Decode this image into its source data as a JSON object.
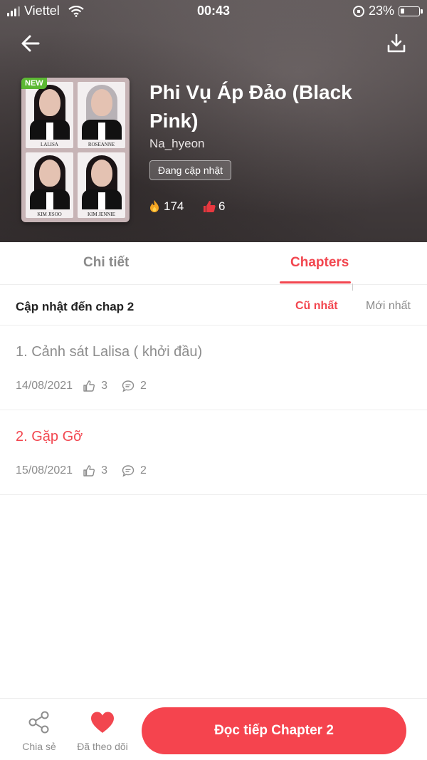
{
  "status_bar": {
    "carrier": "Viettel",
    "time": "00:43",
    "battery": "23%",
    "battery_level": 0.23
  },
  "story": {
    "badge": "NEW",
    "title": "Phi Vụ Áp Đảo (Black Pink)",
    "author": "Na_hyeon",
    "status": "Đang cập nhật",
    "views": "174",
    "likes": "6",
    "cover_captions": [
      "LALISA",
      "ROSEANNE",
      "KIM JISOO",
      "KIM JENNIE"
    ]
  },
  "tabs": [
    {
      "label": "Chi tiết",
      "active": false
    },
    {
      "label": "Chapters",
      "active": true
    }
  ],
  "sort": {
    "label": "Cập nhật đến chap 2",
    "oldest": "Cũ nhất",
    "newest": "Mới nhất",
    "selected": "oldest"
  },
  "chapters": [
    {
      "title": "1. Cảnh sát Lalisa ( khởi đầu)",
      "date": "14/08/2021",
      "likes": "3",
      "comments": "2",
      "active": false
    },
    {
      "title": "2. Gặp Gỡ",
      "date": "15/08/2021",
      "likes": "3",
      "comments": "2",
      "active": true
    }
  ],
  "bottom_bar": {
    "share": "Chia sẻ",
    "follow": "Đã theo dõi",
    "read": "Đọc tiếp Chapter 2"
  },
  "colors": {
    "accent": "#f2464f",
    "muted": "#8d8d8d",
    "badge_new": "#5cb833"
  },
  "icons": [
    "back-arrow-icon",
    "download-icon",
    "fire-icon",
    "thumbs-up-icon",
    "comment-icon",
    "share-icon",
    "heart-icon"
  ]
}
